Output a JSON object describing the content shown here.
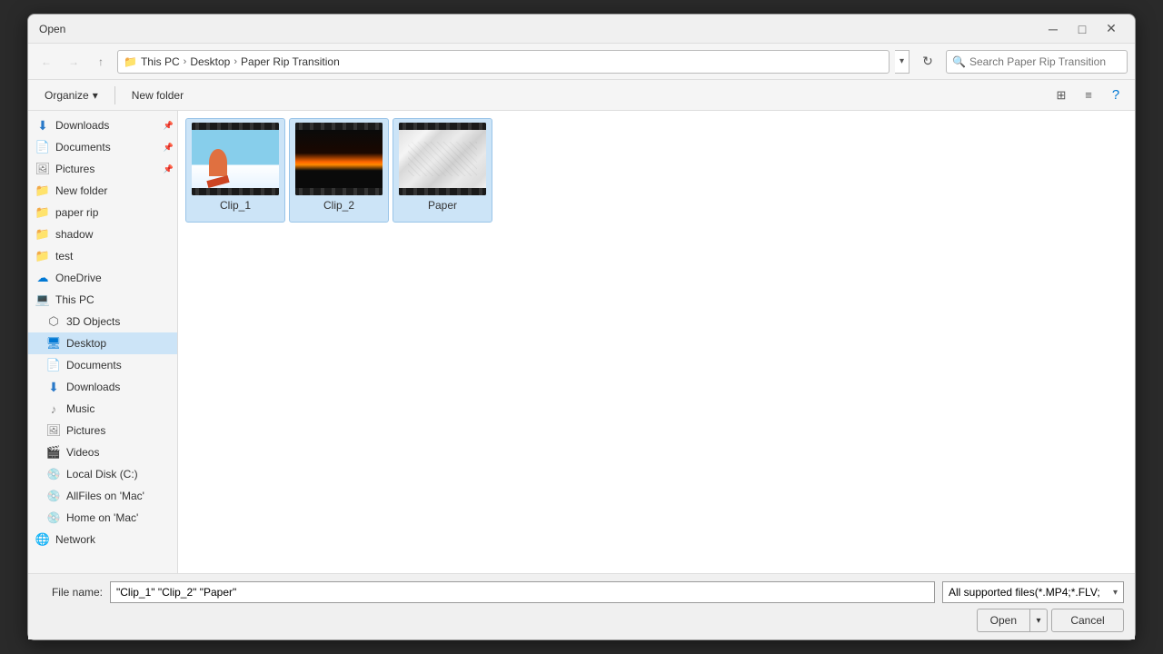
{
  "dialog": {
    "title": "Open",
    "close_btn": "✕"
  },
  "address": {
    "breadcrumbs": [
      "This PC",
      "Desktop",
      "Paper Rip Transition"
    ],
    "search_placeholder": "Search Paper Rip Transition"
  },
  "toolbar": {
    "organize_label": "Organize",
    "organize_arrow": "▾",
    "new_folder_label": "New folder"
  },
  "sidebar": {
    "quick_access": [
      {
        "id": "downloads-quick",
        "label": "Downloads",
        "icon": "downloads",
        "pinned": true
      },
      {
        "id": "documents-quick",
        "label": "Documents",
        "icon": "documents",
        "pinned": true
      },
      {
        "id": "pictures-quick",
        "label": "Pictures",
        "icon": "pictures",
        "pinned": true
      },
      {
        "id": "new-folder-quick",
        "label": "New folder",
        "icon": "folder"
      },
      {
        "id": "paper-rip-quick",
        "label": "paper rip",
        "icon": "folder"
      },
      {
        "id": "shadow-quick",
        "label": "shadow",
        "icon": "folder"
      },
      {
        "id": "test-quick",
        "label": "test",
        "icon": "folder"
      }
    ],
    "onedrive": {
      "id": "onedrive",
      "label": "OneDrive",
      "icon": "onedrive"
    },
    "this_pc": {
      "id": "this-pc",
      "label": "This PC",
      "icon": "thispc"
    },
    "this_pc_items": [
      {
        "id": "3d-objects",
        "label": "3D Objects",
        "icon": "3dobjects"
      },
      {
        "id": "desktop",
        "label": "Desktop",
        "icon": "desktop",
        "active": true
      },
      {
        "id": "documents",
        "label": "Documents",
        "icon": "documents"
      },
      {
        "id": "downloads",
        "label": "Downloads",
        "icon": "downloads"
      },
      {
        "id": "music",
        "label": "Music",
        "icon": "music"
      },
      {
        "id": "pictures",
        "label": "Pictures",
        "icon": "pictures"
      },
      {
        "id": "videos",
        "label": "Videos",
        "icon": "videos"
      },
      {
        "id": "local-disk",
        "label": "Local Disk (C:)",
        "icon": "disk"
      },
      {
        "id": "allfiles-mac",
        "label": "AllFiles on 'Mac'",
        "icon": "disk"
      },
      {
        "id": "home-mac",
        "label": "Home on 'Mac'",
        "icon": "disk"
      }
    ],
    "network": {
      "id": "network",
      "label": "Network",
      "icon": "network"
    }
  },
  "files": [
    {
      "id": "clip1",
      "name": "Clip_1",
      "type": "clip1"
    },
    {
      "id": "clip2",
      "name": "Clip_2",
      "type": "clip2"
    },
    {
      "id": "paper",
      "name": "Paper",
      "type": "paper"
    }
  ],
  "bottom": {
    "filename_label": "File name:",
    "filename_value": "\"Clip_1\" \"Clip_2\" \"Paper\"",
    "filetype_value": "All supported files(*.MP4;*.FLV;",
    "open_label": "Open",
    "cancel_label": "Cancel"
  }
}
